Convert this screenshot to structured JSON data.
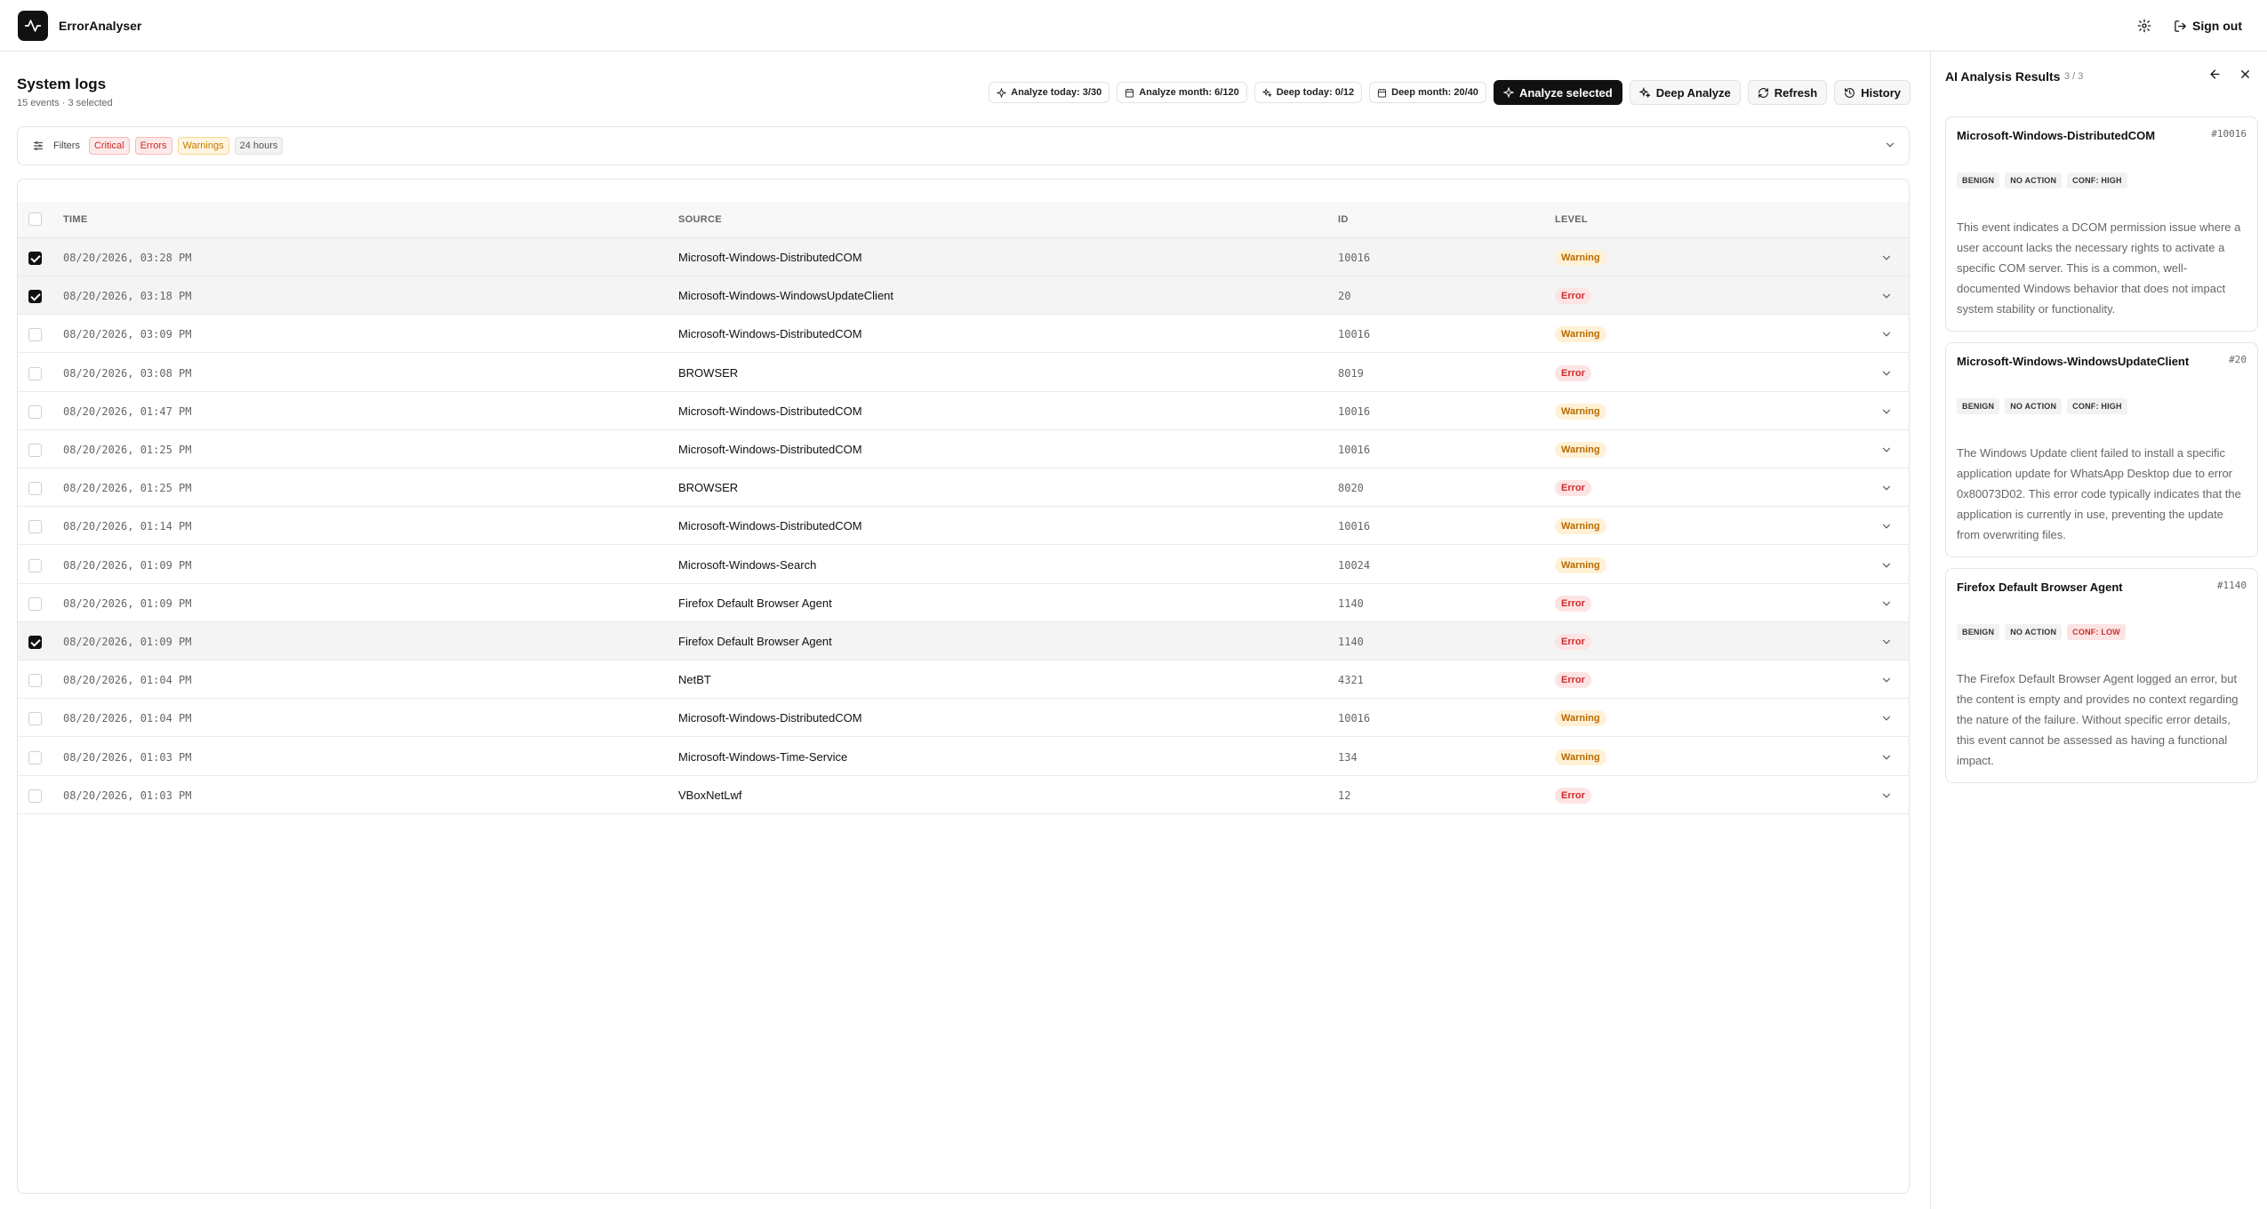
{
  "app": {
    "title": "ErrorAnalyser",
    "signout_label": "Sign out"
  },
  "page": {
    "title": "System logs",
    "subtitle": "15 events · 3 selected"
  },
  "toolbar": {
    "analyze_today": "Analyze today: 3/30",
    "analyze_month": "Analyze month: 6/120",
    "deep_today": "Deep today: 0/12",
    "deep_month": "Deep month: 20/40",
    "analyze_selected_label": "Analyze selected",
    "deep_analyze_label": "Deep Analyze",
    "refresh_label": "Refresh",
    "history_label": "History"
  },
  "filters": {
    "label": "Filters",
    "chips": [
      "Critical",
      "Errors",
      "Warnings",
      "24 hours"
    ]
  },
  "table": {
    "columns": [
      "TIME",
      "SOURCE",
      "ID",
      "LEVEL"
    ],
    "rows": [
      {
        "time": "08/20/2026, 03:28 PM",
        "source": "Microsoft-Windows-DistributedCOM",
        "id": "10016",
        "level": "Warning",
        "selected": true
      },
      {
        "time": "08/20/2026, 03:18 PM",
        "source": "Microsoft-Windows-WindowsUpdateClient",
        "id": "20",
        "level": "Error",
        "selected": true
      },
      {
        "time": "08/20/2026, 03:09 PM",
        "source": "Microsoft-Windows-DistributedCOM",
        "id": "10016",
        "level": "Warning",
        "selected": false
      },
      {
        "time": "08/20/2026, 03:08 PM",
        "source": "BROWSER",
        "id": "8019",
        "level": "Error",
        "selected": false
      },
      {
        "time": "08/20/2026, 01:47 PM",
        "source": "Microsoft-Windows-DistributedCOM",
        "id": "10016",
        "level": "Warning",
        "selected": false
      },
      {
        "time": "08/20/2026, 01:25 PM",
        "source": "Microsoft-Windows-DistributedCOM",
        "id": "10016",
        "level": "Warning",
        "selected": false
      },
      {
        "time": "08/20/2026, 01:25 PM",
        "source": "BROWSER",
        "id": "8020",
        "level": "Error",
        "selected": false
      },
      {
        "time": "08/20/2026, 01:14 PM",
        "source": "Microsoft-Windows-DistributedCOM",
        "id": "10016",
        "level": "Warning",
        "selected": false
      },
      {
        "time": "08/20/2026, 01:09 PM",
        "source": "Microsoft-Windows-Search",
        "id": "10024",
        "level": "Warning",
        "selected": false
      },
      {
        "time": "08/20/2026, 01:09 PM",
        "source": "Firefox Default Browser Agent",
        "id": "1140",
        "level": "Error",
        "selected": false
      },
      {
        "time": "08/20/2026, 01:09 PM",
        "source": "Firefox Default Browser Agent",
        "id": "1140",
        "level": "Error",
        "selected": true
      },
      {
        "time": "08/20/2026, 01:04 PM",
        "source": "NetBT",
        "id": "4321",
        "level": "Error",
        "selected": false
      },
      {
        "time": "08/20/2026, 01:04 PM",
        "source": "Microsoft-Windows-DistributedCOM",
        "id": "10016",
        "level": "Warning",
        "selected": false
      },
      {
        "time": "08/20/2026, 01:03 PM",
        "source": "Microsoft-Windows-Time-Service",
        "id": "134",
        "level": "Warning",
        "selected": false
      },
      {
        "time": "08/20/2026, 01:03 PM",
        "source": "VBoxNetLwf",
        "id": "12",
        "level": "Error",
        "selected": false
      }
    ]
  },
  "panel": {
    "title": "AI Analysis Results",
    "count": "3 / 3",
    "cards": [
      {
        "title": "Microsoft-Windows-DistributedCOM",
        "id": "#10016",
        "tags": [
          "BENIGN",
          "NO ACTION",
          "CONF: HIGH"
        ],
        "body": "This event indicates a DCOM permission issue where a user account lacks the necessary rights to activate a specific COM server. This is a common, well-documented Windows behavior that does not impact system stability or functionality."
      },
      {
        "title": "Microsoft-Windows-WindowsUpdateClient",
        "id": "#20",
        "tags": [
          "BENIGN",
          "NO ACTION",
          "CONF: HIGH"
        ],
        "body": "The Windows Update client failed to install a specific application update for WhatsApp Desktop due to error 0x80073D02. This error code typically indicates that the application is currently in use, preventing the update from overwriting files."
      },
      {
        "title": "Firefox Default Browser Agent",
        "id": "#1140",
        "tags": [
          "BENIGN",
          "NO ACTION",
          "CONF: LOW"
        ],
        "body": "The Firefox Default Browser Agent logged an error, but the content is empty and provides no context regarding the nature of the failure. Without specific error details, this event cannot be assessed as having a functional impact."
      }
    ]
  }
}
